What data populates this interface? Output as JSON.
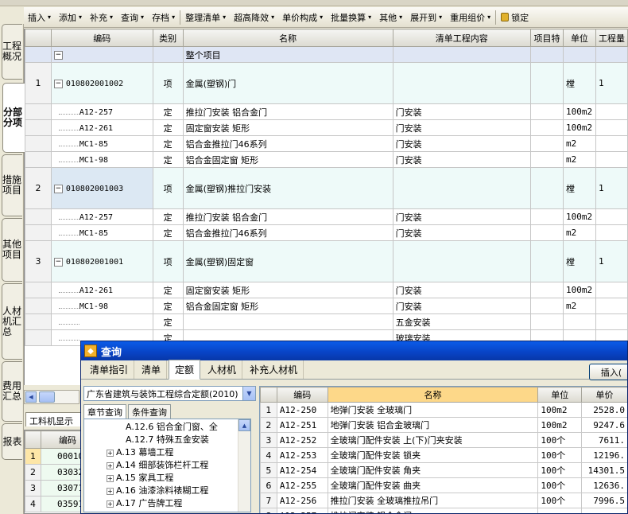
{
  "toolbar": {
    "items": [
      {
        "label": "插入",
        "dd": "▾"
      },
      {
        "label": "添加",
        "dd": "▾"
      },
      {
        "label": "补充",
        "dd": "▾"
      },
      {
        "label": "查询",
        "dd": "▾"
      },
      {
        "label": "存档",
        "dd": "▾"
      },
      {
        "label": "整理清单",
        "dd": "▾"
      },
      {
        "label": "超高降效",
        "dd": "▾"
      },
      {
        "label": "单价构成",
        "dd": "▾"
      },
      {
        "label": "批量换算",
        "dd": "▾"
      },
      {
        "label": "其他",
        "dd": "▾"
      },
      {
        "label": "展开到",
        "dd": "▾"
      },
      {
        "label": "重用组价",
        "dd": "▾"
      },
      {
        "label": "锁定",
        "dd": ""
      }
    ]
  },
  "side_tabs": [
    {
      "label": "工程概况"
    },
    {
      "label": "分部分项"
    },
    {
      "label": "措施项目"
    },
    {
      "label": "其他项目"
    },
    {
      "label": "人材机汇总"
    },
    {
      "label": "费用汇总"
    },
    {
      "label": "报表"
    }
  ],
  "grid": {
    "headers": [
      "编码",
      "类别",
      "名称",
      "清单工程内容",
      "项目特",
      "单位",
      "工程量"
    ],
    "summary": {
      "name": "整个项目",
      "toggle": "−"
    },
    "rows": [
      {
        "no": "1",
        "code": "010802001002",
        "type": "项",
        "name": "金属(塑钢)门",
        "content": "",
        "unit": "樘",
        "qty": "1"
      },
      {
        "no": "",
        "code": "A12-257",
        "type": "定",
        "name": "推拉门安装 铝合金门",
        "content": "门安装",
        "unit": "100m2",
        "qty": ""
      },
      {
        "no": "",
        "code": "A12-261",
        "type": "定",
        "name": "固定窗安装 矩形",
        "content": "门安装",
        "unit": "100m2",
        "qty": ""
      },
      {
        "no": "",
        "code": "MC1-85",
        "type": "定",
        "name": "铝合金推拉门46系列",
        "content": "门安装",
        "unit": "m2",
        "qty": ""
      },
      {
        "no": "",
        "code": "MC1-98",
        "type": "定",
        "name": "铝合金固定窗 矩形",
        "content": "门安装",
        "unit": "m2",
        "qty": ""
      },
      {
        "no": "2",
        "code": "010802001003",
        "type": "项",
        "name": "金属(塑钢)推拉门安装",
        "content": "",
        "unit": "樘",
        "qty": "1"
      },
      {
        "no": "",
        "code": "A12-257",
        "type": "定",
        "name": "推拉门安装 铝合金门",
        "content": "门安装",
        "unit": "100m2",
        "qty": ""
      },
      {
        "no": "",
        "code": "MC1-85",
        "type": "定",
        "name": "铝合金推拉门46系列",
        "content": "门安装",
        "unit": "m2",
        "qty": ""
      },
      {
        "no": "3",
        "code": "010802001001",
        "type": "项",
        "name": "金属(塑钢)固定窗",
        "content": "",
        "unit": "樘",
        "qty": "1"
      },
      {
        "no": "",
        "code": "A12-261",
        "type": "定",
        "name": "固定窗安装 矩形",
        "content": "门安装",
        "unit": "100m2",
        "qty": ""
      },
      {
        "no": "",
        "code": "MC1-98",
        "type": "定",
        "name": "铝合金固定窗 矩形",
        "content": "门安装",
        "unit": "m2",
        "qty": ""
      },
      {
        "no": "",
        "code": "",
        "type": "定",
        "name": "",
        "content": "五金安装",
        "unit": "",
        "qty": ""
      },
      {
        "no": "",
        "code": "",
        "type": "定",
        "name": "",
        "content": "玻璃安装",
        "unit": "",
        "qty": ""
      }
    ]
  },
  "bottom": {
    "tab_label": "工料机显示",
    "header": "编码",
    "rows": [
      {
        "no": "1",
        "code": "00010"
      },
      {
        "no": "2",
        "code": "03032"
      },
      {
        "no": "3",
        "code": "03071"
      },
      {
        "no": "4",
        "code": "03591"
      }
    ]
  },
  "dialog": {
    "title": "查询",
    "tabs": [
      "清单指引",
      "清单",
      "定额",
      "人材机",
      "补充人材机"
    ],
    "active_tab": "定额",
    "insert_label": "插入(",
    "library": "广东省建筑与装饰工程综合定额(2010)",
    "left_tabs": [
      "章节查询",
      "条件查询"
    ],
    "tree": [
      {
        "label": "A.12.6 铝合金门窗、全",
        "level": 2,
        "toggle": ""
      },
      {
        "label": "A.12.7 特殊五金安装",
        "level": 2,
        "toggle": ""
      },
      {
        "label": "A.13 幕墙工程",
        "level": 1,
        "toggle": "+"
      },
      {
        "label": "A.14 细部装饰栏杆工程",
        "level": 1,
        "toggle": "+"
      },
      {
        "label": "A.15 家具工程",
        "level": 1,
        "toggle": "+"
      },
      {
        "label": "A.16 油漆涂料裱糊工程",
        "level": 1,
        "toggle": "+"
      },
      {
        "label": "A.17 广告牌工程",
        "level": 1,
        "toggle": "+"
      }
    ],
    "headers": [
      "编码",
      "名称",
      "单位",
      "单价"
    ],
    "rows": [
      {
        "no": "1",
        "code": "A12-250",
        "name": "地弹门安装 全玻璃门",
        "unit": "100m2",
        "price": "2528.0"
      },
      {
        "no": "2",
        "code": "A12-251",
        "name": "地弹门安装 铝合金玻璃门",
        "unit": "100m2",
        "price": "9247.6"
      },
      {
        "no": "3",
        "code": "A12-252",
        "name": "全玻璃门配件安装 上(下)门夹安装",
        "unit": "100个",
        "price": "7611."
      },
      {
        "no": "4",
        "code": "A12-253",
        "name": "全玻璃门配件安装 锁夹",
        "unit": "100个",
        "price": "12196."
      },
      {
        "no": "5",
        "code": "A12-254",
        "name": "全玻璃门配件安装 角夹",
        "unit": "100个",
        "price": "14301.5"
      },
      {
        "no": "6",
        "code": "A12-255",
        "name": "全玻璃门配件安装 曲夹",
        "unit": "100个",
        "price": "12636."
      },
      {
        "no": "7",
        "code": "A12-256",
        "name": "推拉门安装 全玻璃推拉吊门",
        "unit": "100个",
        "price": "7996.5"
      },
      {
        "no": "8",
        "code": "A12-257",
        "name": "推拉门安装 铝合金门",
        "unit": "",
        "price": ""
      }
    ]
  }
}
